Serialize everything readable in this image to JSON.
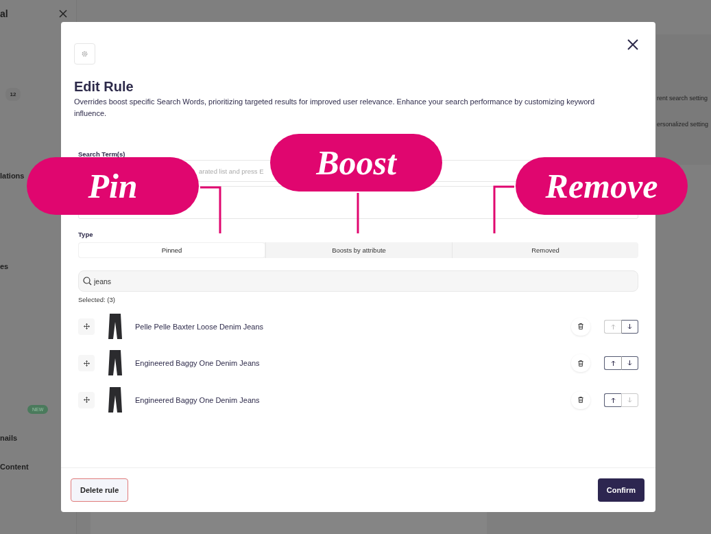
{
  "background": {
    "sidebar": {
      "title": "al",
      "items": [
        {
          "kind": "badge",
          "label": "12"
        },
        {
          "kind": "text",
          "label": "lations"
        },
        {
          "kind": "text",
          "label": "es"
        },
        {
          "kind": "new",
          "label": "NEW"
        },
        {
          "kind": "text",
          "label": "nails"
        },
        {
          "kind": "text",
          "label": "Content"
        }
      ]
    },
    "panel": {
      "lines": [
        "rent search setting",
        "ersonalized setting"
      ]
    }
  },
  "modal": {
    "title": "Edit Rule",
    "description": "Overrides boost specific Search Words, prioritizing targeted results for improved user relevance. Enhance your search performance by customizing keyword influence.",
    "search_terms": {
      "label": "Search Term(s)",
      "placeholder": "arated list and press E"
    },
    "type": {
      "label": "Type",
      "tabs": [
        {
          "label": "Pinned",
          "selected": true
        },
        {
          "label": "Boosts by attribute",
          "selected": false
        },
        {
          "label": "Removed",
          "selected": false
        }
      ]
    },
    "search": {
      "value": "jeans"
    },
    "selected_label": "Selected: (3)",
    "items": [
      {
        "name": "Pelle Pelle Baxter Loose Denim Jeans",
        "up_disabled": true,
        "down_disabled": false
      },
      {
        "name": "Engineered Baggy One Denim Jeans",
        "up_disabled": false,
        "down_disabled": false
      },
      {
        "name": "Engineered Baggy One Denim Jeans",
        "up_disabled": false,
        "down_disabled": true
      }
    ],
    "buttons": {
      "delete": "Delete rule",
      "confirm": "Confirm"
    }
  },
  "annotations": [
    {
      "label": "Pin"
    },
    {
      "label": "Boost"
    },
    {
      "label": "Remove"
    }
  ]
}
